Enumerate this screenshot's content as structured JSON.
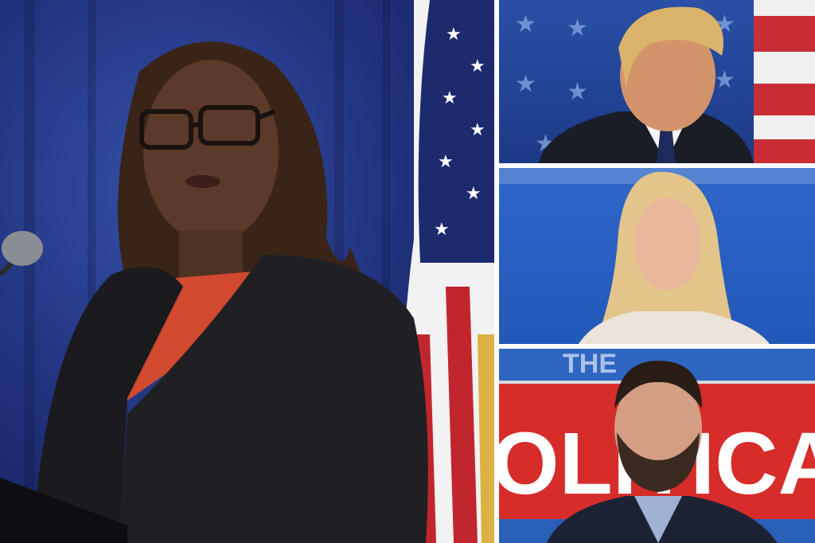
{
  "collage": {
    "panels": [
      {
        "subject": "woman speaking at podium with glasses"
      },
      {
        "subject": "man in suit and tie against stars background"
      },
      {
        "subject": "blonde woman speaking on stage"
      },
      {
        "subject": "bearded man in front of red banner"
      }
    ],
    "banner_text": {
      "top_line": "THE",
      "main_line": "OLITICA"
    },
    "colors": {
      "background_blue": "#1f2f78",
      "flag_red": "#c1262d",
      "flag_white": "#f2f2f2",
      "banner_red": "#d62c2a"
    }
  }
}
